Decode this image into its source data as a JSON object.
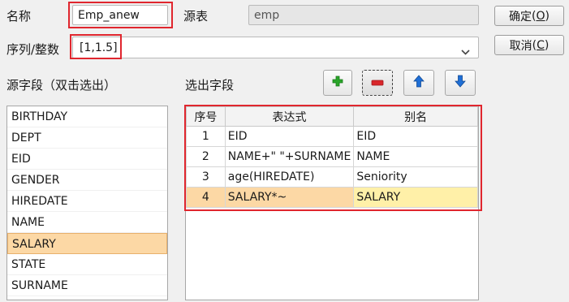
{
  "form": {
    "name_label": "名称",
    "name_value": "Emp_anew",
    "source_label": "源表",
    "source_value": "emp",
    "seq_label": "序列/整数",
    "seq_value": "[1,1.5]"
  },
  "buttons": {
    "ok_label": "确定",
    "ok_key": "O",
    "cancel_label": "取消",
    "cancel_key": "C"
  },
  "source_fields": {
    "title": "源字段（双击选出）",
    "items": [
      "BIRTHDAY",
      "DEPT",
      "EID",
      "GENDER",
      "HIREDATE",
      "NAME",
      "SALARY",
      "STATE",
      "SURNAME"
    ],
    "selected": "SALARY"
  },
  "selected_fields": {
    "title": "选出字段",
    "columns": [
      "序号",
      "表达式",
      "别名"
    ],
    "rows": [
      {
        "no": "1",
        "expr": "EID",
        "alias": "EID"
      },
      {
        "no": "2",
        "expr": "NAME+\" \"+SURNAME",
        "alias": "NAME"
      },
      {
        "no": "3",
        "expr": "age(HIREDATE)",
        "alias": "Seniority"
      },
      {
        "no": "4",
        "expr": "SALARY*~",
        "alias": "SALARY"
      }
    ]
  },
  "toolbar": {
    "icons": [
      "plus-icon",
      "minus-icon",
      "arrow-up-icon",
      "arrow-down-icon"
    ]
  },
  "colors": {
    "highlight_red": "#e0262e",
    "selection_orange": "#fcd8a5",
    "alias_yellow": "#fff0a8",
    "plus_green": "#2aa52a",
    "minus_red": "#d9262b",
    "arrow_blue": "#1f6fd6"
  }
}
